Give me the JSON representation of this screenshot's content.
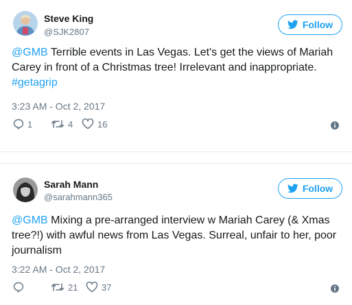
{
  "tweets": [
    {
      "name": "Steve King",
      "handle": "@SJK2807",
      "follow_label": "Follow",
      "mention": "@GMB",
      "body": " Terrible events in Las Vegas. Let's get the views of Mariah Carey in front of a Christmas tree! Irrelevant and inappropriate. ",
      "hashtag": "#getagrip",
      "timestamp": "3:23 AM - Oct 2, 2017",
      "reply_count": "1",
      "retweet_count": "4",
      "like_count": "16"
    },
    {
      "name": "Sarah Mann",
      "handle": "@sarahmann365",
      "follow_label": "Follow",
      "mention": "@GMB",
      "body": " Mixing a pre-arranged interview w Mariah Carey (& Xmas tree?!) with awful news from Las Vegas. Surreal, unfair to her, poor journalism",
      "hashtag": "",
      "timestamp": "3:22 AM - Oct 2, 2017",
      "reply_count": "",
      "retweet_count": "21",
      "like_count": "37"
    }
  ],
  "icons": {
    "follow": "twitter-bird-icon",
    "reply": "reply-icon",
    "retweet": "retweet-icon",
    "like": "heart-icon",
    "info": "info-icon"
  },
  "colors": {
    "accent": "#1da1f2",
    "muted": "#657786",
    "text": "#14171a"
  }
}
